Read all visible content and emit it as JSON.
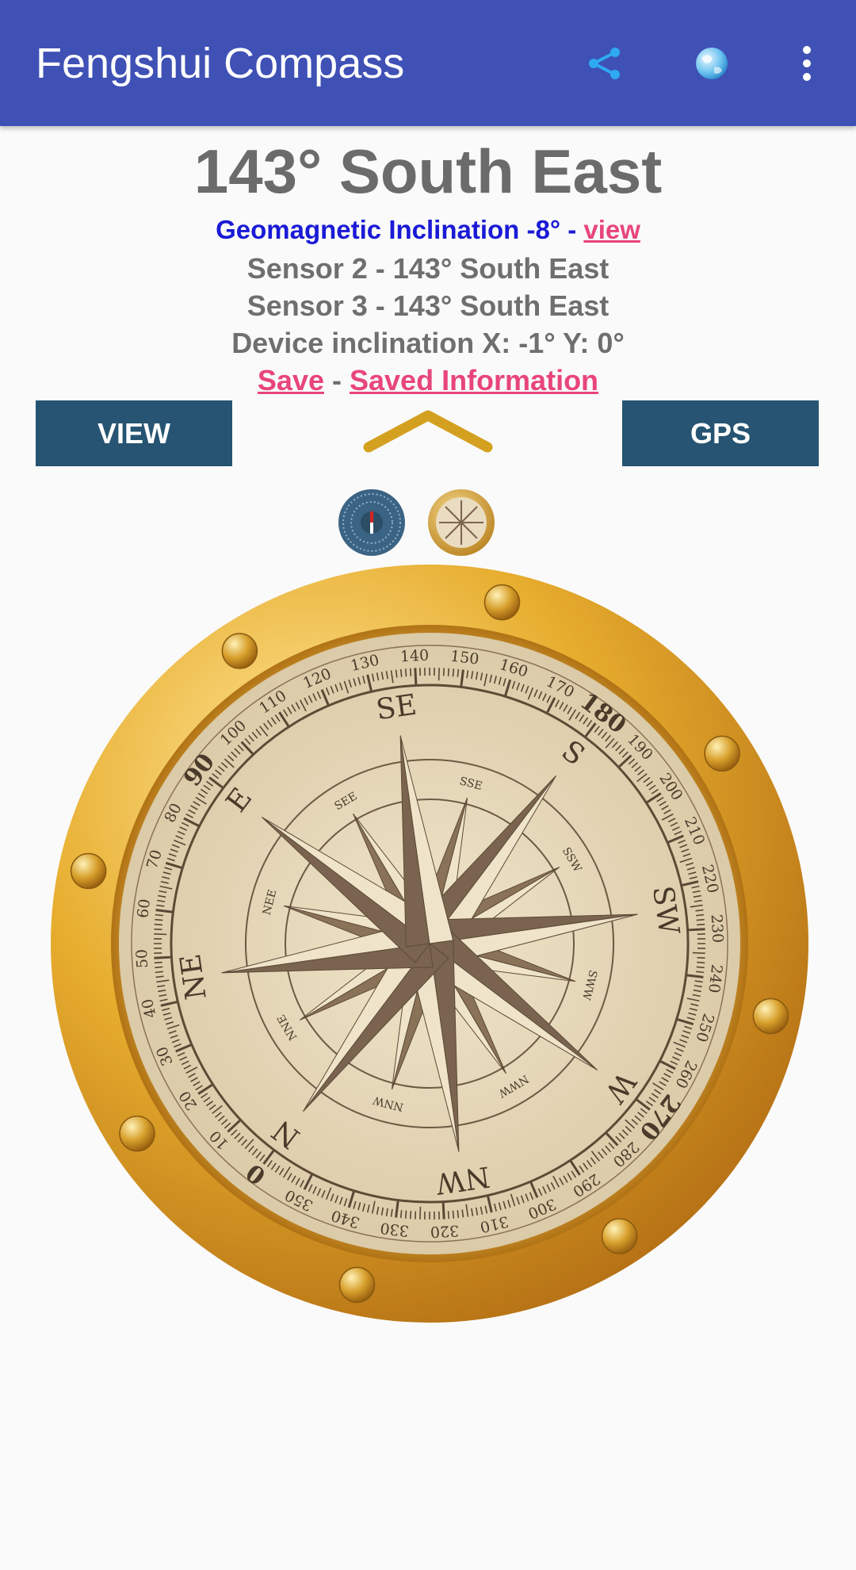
{
  "appbar": {
    "title": "Fengshui Compass",
    "icons": [
      "share-icon",
      "globe-icon",
      "more-vert-icon"
    ],
    "color": "#3f51b5"
  },
  "reading": {
    "heading": "143° South East",
    "geo_text": "Geomagnetic Inclination -8° - ",
    "geo_link": "view",
    "sensor2": "Sensor 2 - 143° South East",
    "sensor3": "Sensor 3 - 143° South East",
    "device_inclination": "Device inclination X: -1° Y: 0°",
    "save_link": " Save",
    "separator": " - ",
    "saved_info_link": " Saved Information"
  },
  "buttons": {
    "view_label": "VIEW",
    "gps_label": "GPS",
    "color": "#265472"
  },
  "compass": {
    "heading_degrees": 143,
    "cardinal": [
      "SE",
      "S",
      "SW",
      "W",
      "NW",
      "N",
      "NE",
      "E"
    ],
    "inter": [
      "SSE",
      "SSW",
      "SWW",
      "NWW",
      "NNW",
      "NNE",
      "NEE",
      "SEE"
    ],
    "degree_labels": [
      "0",
      "10",
      "20",
      "30",
      "40",
      "50",
      "60",
      "70",
      "80",
      "90",
      "100",
      "110",
      "120",
      "130",
      "140",
      "150",
      "160",
      "170",
      "180",
      "190",
      "200",
      "210",
      "220",
      "230",
      "240",
      "250",
      "260",
      "270",
      "280",
      "290",
      "300",
      "310",
      "320",
      "330",
      "340",
      "350"
    ],
    "rim_color": "#d89a20",
    "face_color": "#e8dcc0",
    "star_color": "#7a6450"
  },
  "theme_icons": [
    "compass-theme-blue-icon",
    "compass-theme-gold-icon"
  ]
}
